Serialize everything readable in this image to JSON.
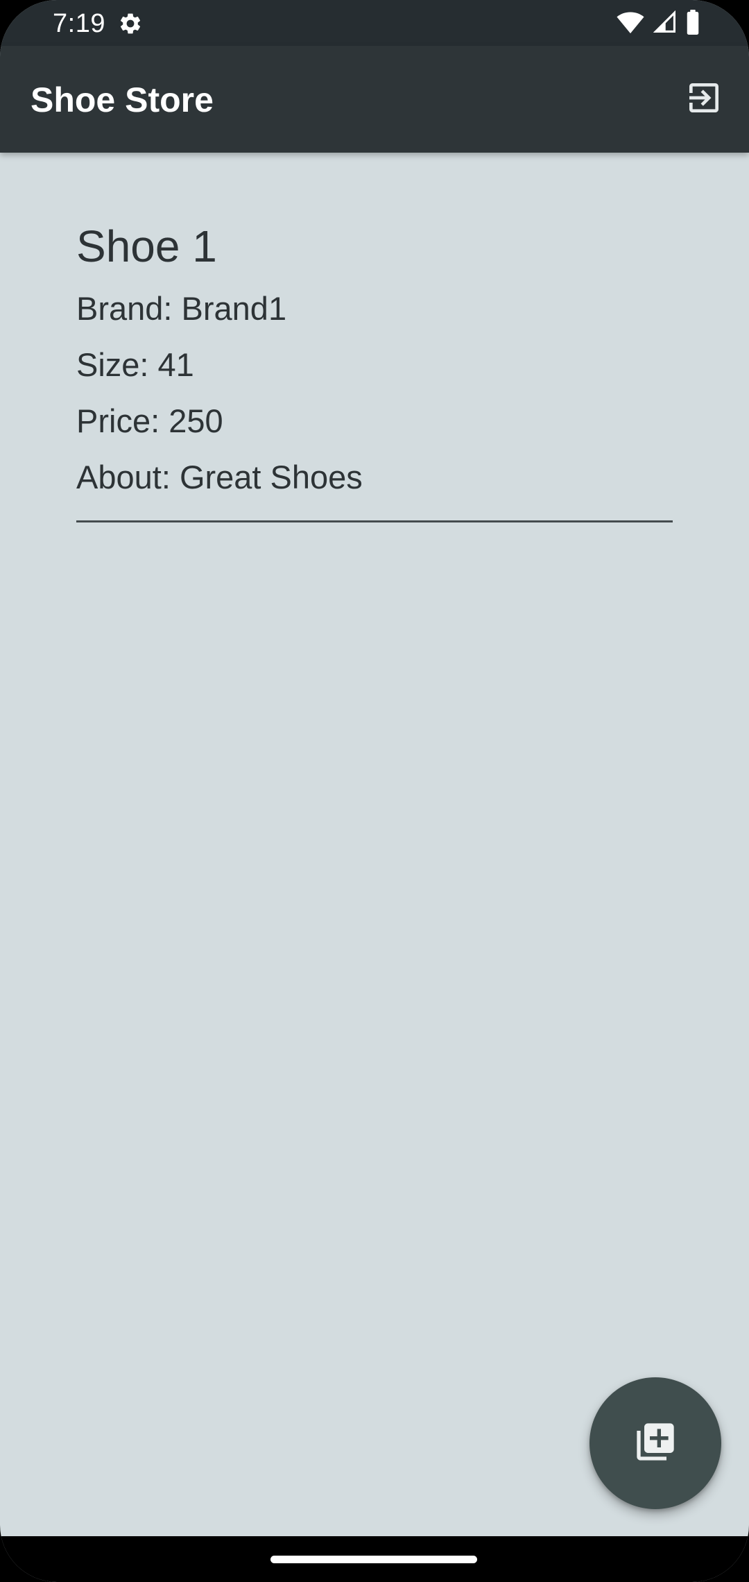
{
  "status_bar": {
    "time": "7:19",
    "icons": [
      "settings-icon",
      "wifi-icon",
      "signal-icon",
      "battery-icon"
    ]
  },
  "app_bar": {
    "title": "Shoe Store",
    "action_icon": "logout-icon"
  },
  "shoes": [
    {
      "name": "Shoe 1",
      "brand": "Brand: Brand1",
      "size": "Size: 41",
      "price": "Price: 250",
      "about": "About: Great Shoes"
    }
  ],
  "fab": {
    "icon": "add-to-list-icon"
  },
  "colors": {
    "status_bar": "#262d31",
    "app_bar": "#2e3538",
    "background": "#d3dcdf",
    "text": "#2d3336",
    "fab": "#404e4e"
  }
}
